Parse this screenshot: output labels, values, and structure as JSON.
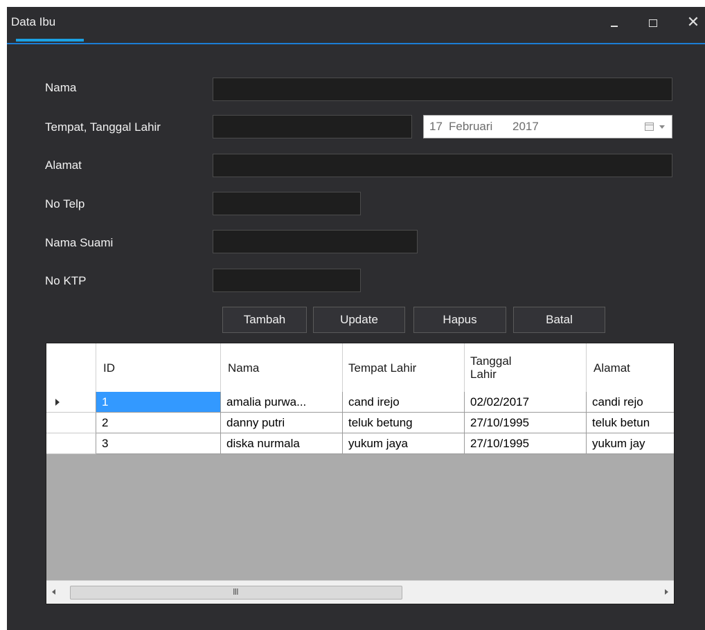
{
  "window": {
    "title": "Data Ibu",
    "minimize_glyph": "_",
    "maximize_glyph": "□",
    "close_glyph": "✕"
  },
  "form": {
    "nama_label": "Nama",
    "ttl_label": "Tempat, Tanggal Lahir",
    "alamat_label": "Alamat",
    "telp_label": "No Telp",
    "suami_label": "Nama Suami",
    "ktp_label": "No KTP",
    "nama_value": "",
    "tempat_value": "",
    "alamat_value": "",
    "telp_value": "",
    "suami_value": "",
    "ktp_value": "",
    "date": {
      "day": "17",
      "month": "Februari",
      "year": "2017"
    }
  },
  "buttons": {
    "tambah": "Tambah",
    "update": "Update",
    "hapus": "Hapus",
    "batal": "Batal"
  },
  "grid": {
    "columns": [
      {
        "label": "ID"
      },
      {
        "label": "Nama"
      },
      {
        "label": "Tempat Lahir"
      },
      {
        "label": "Tanggal Lahir"
      },
      {
        "label": "Alamat"
      }
    ],
    "rows": [
      {
        "id": "1",
        "nama": "amalia purwa...",
        "tempat": "cand irejo",
        "tanggal": "02/02/2017",
        "alamat": "candi rejo"
      },
      {
        "id": "2",
        "nama": "danny putri",
        "tempat": "teluk betung",
        "tanggal": "27/10/1995",
        "alamat": "teluk betun"
      },
      {
        "id": "3",
        "nama": "diska nurmala",
        "tempat": "yukum jaya",
        "tanggal": "27/10/1995",
        "alamat": "yukum jay"
      }
    ],
    "scroll_grip": "III"
  },
  "colors": {
    "window_bg": "#2d2d30",
    "accent": "#1ba1e2",
    "field_bg": "#1e1e1e",
    "selection": "#3399ff",
    "grid_empty": "#ababab"
  }
}
